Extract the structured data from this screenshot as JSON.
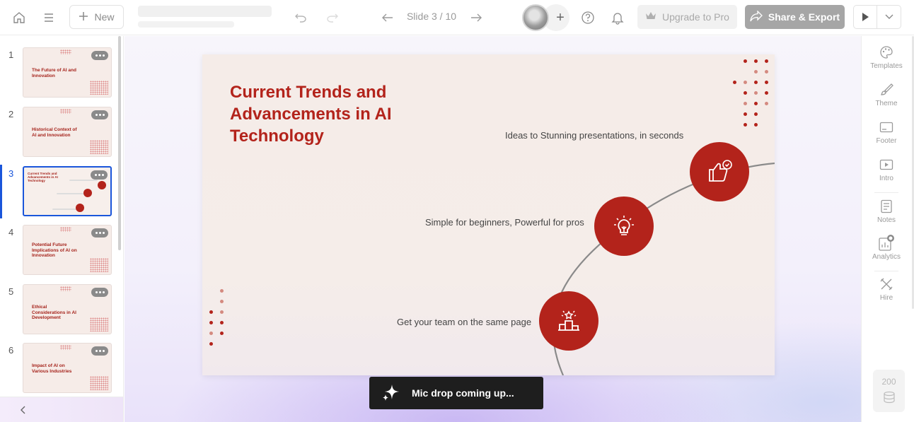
{
  "topbar": {
    "new_label": "New",
    "slide_counter": "Slide 3 / 10",
    "avatar_add": "+",
    "upgrade_label": "Upgrade to Pro",
    "share_label": "Share & Export"
  },
  "slides": [
    {
      "num": "1",
      "title": "The Future of AI and Innovation"
    },
    {
      "num": "2",
      "title": "Historical Context of AI and Innovation"
    },
    {
      "num": "3",
      "title": "Current Trends and Advancements in AI Technology"
    },
    {
      "num": "4",
      "title": "Potential Future Implications of AI on Innovation"
    },
    {
      "num": "5",
      "title": "Ethical Considerations in AI Development"
    },
    {
      "num": "6",
      "title": "Impact of AI on Various Industries"
    }
  ],
  "active_slide": {
    "title": "Current Trends and Advancements in AI Technology",
    "point_1": "Ideas to Stunning presentations, in seconds",
    "point_2": "Simple for beginners, Powerful for pros",
    "point_3": "Get your team on the same page"
  },
  "toast": {
    "text": "Mic drop coming up..."
  },
  "rightbar": {
    "templates": "Templates",
    "theme": "Theme",
    "footer": "Footer",
    "intro": "Intro",
    "notes": "Notes",
    "analytics": "Analytics",
    "hire": "Hire",
    "credits": "200"
  },
  "colors": {
    "accent": "#b3231b",
    "active_blue": "#1a56db",
    "slide_bg": "#f5ece8",
    "toast_bg": "#1e1e1e"
  }
}
